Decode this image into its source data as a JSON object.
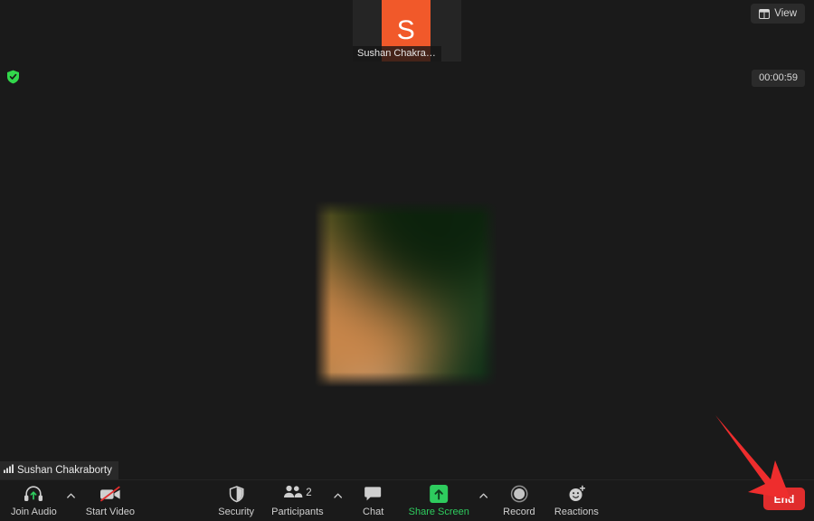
{
  "window": {
    "app_name": "Zoom Meeting",
    "background_color": "#1a1a1a"
  },
  "filmstrip": {
    "participant": {
      "initial": "S",
      "name_truncated": "Sushan Chakrab...",
      "avatar_color": "#f1592a"
    }
  },
  "header": {
    "view_button": {
      "label": "View",
      "icon": "layout-grid-icon"
    },
    "encryption_icon": "shield-check-icon",
    "encryption_color": "#32d74b",
    "timer": "00:00:59"
  },
  "stage": {
    "active_speaker_video": "blurred-video-feed",
    "self_label": "Sushan Chakraborty",
    "self_signal_icon": "signal-bars-icon"
  },
  "toolbar": {
    "left": [
      {
        "label": "Join Audio",
        "icon": "headset-icon",
        "has_caret": true
      },
      {
        "label": "Start Video",
        "icon": "video-off-icon",
        "has_caret": false
      }
    ],
    "center": [
      {
        "label": "Security",
        "icon": "shield-icon",
        "has_caret": false,
        "count": ""
      },
      {
        "label": "Participants",
        "icon": "participants-icon",
        "has_caret": true,
        "count": "2"
      },
      {
        "label": "Chat",
        "icon": "chat-bubble-icon",
        "has_caret": false,
        "count": ""
      },
      {
        "label": "Share Screen",
        "icon": "share-screen-icon",
        "has_caret": true,
        "count": "",
        "highlight": true
      },
      {
        "label": "Record",
        "icon": "record-circle-icon",
        "has_caret": false,
        "count": ""
      },
      {
        "label": "Reactions",
        "icon": "reactions-icon",
        "has_caret": false,
        "count": ""
      }
    ],
    "end_button": {
      "label": "End",
      "color": "#e02d2d"
    },
    "accent_green": "#2ecc5e"
  },
  "annotation": {
    "arrow": "red-arrow-pointing-to-end-button",
    "color": "#ee2d2d"
  }
}
